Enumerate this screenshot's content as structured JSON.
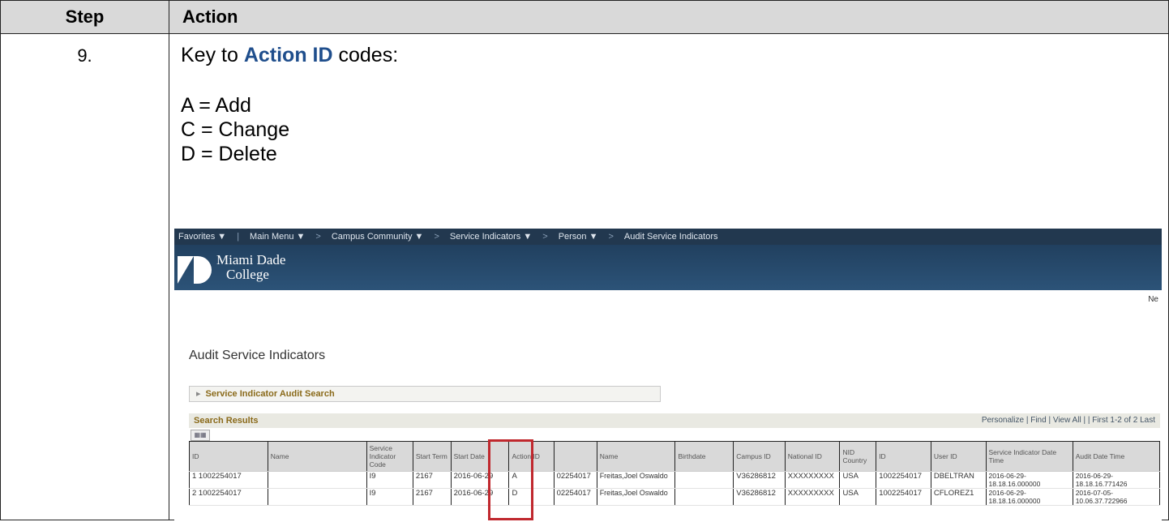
{
  "table": {
    "header_step": "Step",
    "header_action": "Action",
    "step_number": "9.",
    "key_prefix": "Key to ",
    "key_highlight": "Action ID",
    "key_suffix": " codes:",
    "codes": [
      "A = Add",
      "C = Change",
      "D = Delete"
    ]
  },
  "screenshot": {
    "nav": [
      "Favorites ▼",
      "Main Menu ▼",
      "Campus Community ▼",
      "Service Indicators ▼",
      "Person ▼",
      "Audit Service Indicators"
    ],
    "logo_line1": "Miami Dade",
    "logo_line2": "College",
    "corner_text": "Ne",
    "page_title": "Audit Service Indicators",
    "search_section": "Service Indicator Audit Search",
    "results_title": "Search Results",
    "results_tools": "Personalize | Find | View All |  |      First  1-2 of 2  Last",
    "columns": [
      "ID",
      "Name",
      "Service Indicator Code",
      "Start Term",
      "Start Date",
      "Action ID",
      "",
      "Name",
      "Birthdate",
      "Campus ID",
      "National ID",
      "NID Country",
      "ID",
      "User ID",
      "Service Indicator Date Time",
      "Audit Date Time"
    ],
    "rows": [
      [
        "1 1002254017",
        "",
        "I9",
        "2167",
        "2016-06-29",
        "A",
        "02254017",
        "Freitas,Joel Oswaldo",
        "",
        "V36286812",
        "XXXXXXXXX",
        "USA",
        "1002254017",
        "DBELTRAN",
        "2016-06-29-18.18.16.000000",
        "2016-06-29-18.18.16.771426"
      ],
      [
        "2 1002254017",
        "",
        "I9",
        "2167",
        "2016-06-29",
        "D",
        "02254017",
        "Freitas,Joel Oswaldo",
        "",
        "V36286812",
        "XXXXXXXXX",
        "USA",
        "1002254017",
        "CFLOREZ1",
        "2016-06-29-18.18.16.000000",
        "2016-07-05-10.06.37.722966"
      ]
    ],
    "highlight_color": "#c0282e"
  }
}
